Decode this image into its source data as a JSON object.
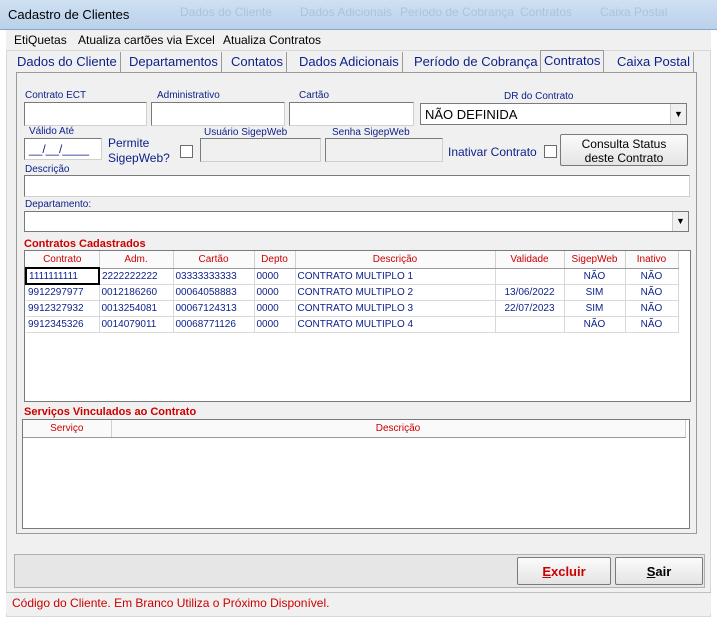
{
  "window": {
    "title": "Cadastro de Clientes",
    "ghost_titles": [
      "Dados do Cliente",
      "Dados Adicionais",
      "Período de Cobrança",
      "Contratos",
      "Caixa Postal"
    ]
  },
  "menu": {
    "items": [
      "EtiQuetas",
      "Atualiza cartões via Excel",
      "Atualiza Contratos"
    ]
  },
  "tabs": [
    "Dados do Cliente",
    "Departamentos",
    "Contatos",
    "Dados Adicionais",
    "Período de Cobrança",
    "Contratos",
    "Caixa Postal"
  ],
  "active_tab": "Contratos",
  "form": {
    "contrato_ect_label": "Contrato ECT",
    "administrativo_label": "Administrativo",
    "cartao_label": "Cartão",
    "dr_label": "DR do Contrato",
    "dr_value": "NÃO DEFINIDA",
    "valido_label": "Válido Até",
    "valido_value": "__/__/____",
    "permite_label_1": "Permite",
    "permite_label_2": "SigepWeb?",
    "usuario_label": "Usuário SigepWeb",
    "senha_label": "Senha SigepWeb",
    "inativar_label": "Inativar Contrato",
    "consulta_btn_1": "Consulta Status",
    "consulta_btn_2": "deste Contrato",
    "descricao_label": "Descrição",
    "departamento_label": "Departamento:"
  },
  "contratos": {
    "section_title": "Contratos Cadastrados",
    "columns": [
      "Contrato",
      "Adm.",
      "Cartão",
      "Depto",
      "Descrição",
      "Validade",
      "SigepWeb",
      "Inativo"
    ],
    "rows": [
      [
        "1111111111",
        "2222222222",
        "03333333333",
        "0000",
        "CONTRATO MULTIPLO 1",
        "",
        "NÃO",
        "NÃO"
      ],
      [
        "9912297977",
        "0012186260",
        "00064058883",
        "0000",
        "CONTRATO MULTIPLO 2",
        "13/06/2022",
        "SIM",
        "NÃO"
      ],
      [
        "9912327932",
        "0013254081",
        "00067124313",
        "0000",
        "CONTRATO MULTIPLO 3",
        "22/07/2023",
        "SIM",
        "NÃO"
      ],
      [
        "9912345326",
        "0014079011",
        "00068771126",
        "0000",
        "CONTRATO MULTIPLO 4",
        "",
        "NÃO",
        "NÃO"
      ]
    ]
  },
  "servicos": {
    "section_title": "Serviços Vinculados ao Contrato",
    "columns": [
      "Serviço",
      "Descrição"
    ]
  },
  "buttons": {
    "excluir_first": "E",
    "excluir_rest": "xcluir",
    "sair_first": "S",
    "sair_rest": "air"
  },
  "status": "Código do Cliente. Em Branco Utiliza o Próximo Disponível.",
  "colors": {
    "label_blue": "#0b1f8a",
    "accent_red": "#cc0000",
    "titlebar": "#b9d1ea"
  }
}
